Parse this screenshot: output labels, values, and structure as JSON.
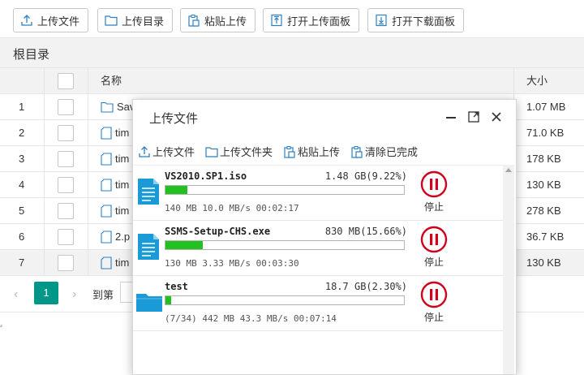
{
  "toolbar": {
    "upload_file": "上传文件",
    "upload_dir": "上传目录",
    "paste_upload": "粘贴上传",
    "open_upload_panel": "打开上传面板",
    "open_download_panel": "打开下载面板"
  },
  "breadcrumb": "根目录",
  "table": {
    "col_name": "名称",
    "col_size": "大小",
    "rows": [
      {
        "index": "1",
        "name": "Sav",
        "icon": "folder-icon",
        "size": "1.07 MB"
      },
      {
        "index": "2",
        "name": "tim",
        "icon": "file-icon",
        "size": "71.0 KB"
      },
      {
        "index": "3",
        "name": "tim",
        "icon": "file-icon",
        "size": "178 KB"
      },
      {
        "index": "4",
        "name": "tim",
        "icon": "file-icon",
        "size": "130 KB"
      },
      {
        "index": "5",
        "name": "tim",
        "icon": "file-icon",
        "size": "278 KB"
      },
      {
        "index": "6",
        "name": "2.p",
        "icon": "file-icon",
        "size": "36.7 KB"
      },
      {
        "index": "7",
        "name": "tim",
        "icon": "file-icon",
        "size": "130 KB"
      }
    ]
  },
  "pager": {
    "current": "1",
    "goto": "到第"
  },
  "dialog": {
    "title": "上传文件",
    "toolbar": {
      "upload_file": "上传文件",
      "upload_folder": "上传文件夹",
      "paste_upload": "粘贴上传",
      "clear_done": "清除已完成"
    },
    "items": [
      {
        "name": "VS2010.SP1.iso",
        "size": "1.48 GB(9.22%)",
        "progress": 0.0922,
        "status": "140 MB 10.0 MB/s 00:02:17",
        "stop": "停止",
        "icon": "document-icon"
      },
      {
        "name": "SSMS-Setup-CHS.exe",
        "size": "830 MB(15.66%)",
        "progress": 0.1566,
        "status": "130 MB 3.33 MB/s 00:03:30",
        "stop": "停止",
        "icon": "document-icon"
      },
      {
        "name": "test",
        "size": "18.7 GB(2.30%)",
        "progress": 0.023,
        "status": "(7/34) 442 MB 43.3 MB/s 00:07:14",
        "stop": "停止",
        "icon": "folder-icon"
      }
    ]
  },
  "colors": {
    "accent": "#009688",
    "progress": "#22c11f",
    "stop": "#d0021b",
    "file_icon": "#1a9ad6"
  }
}
